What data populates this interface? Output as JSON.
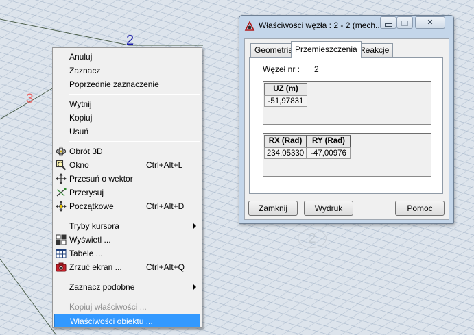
{
  "viewport": {
    "node_labels": [
      "2",
      "3",
      "2"
    ]
  },
  "context_menu": {
    "items": [
      {
        "label": "Anuluj",
        "shortcut": "",
        "icon": "",
        "disabled": false
      },
      {
        "label": "Zaznacz",
        "shortcut": "",
        "icon": "",
        "disabled": false
      },
      {
        "label": "Poprzednie zaznaczenie",
        "shortcut": "",
        "icon": "",
        "disabled": false
      },
      {
        "label": "Wytnij",
        "shortcut": "",
        "icon": "",
        "disabled": false
      },
      {
        "label": "Kopiuj",
        "shortcut": "",
        "icon": "",
        "disabled": false
      },
      {
        "label": "Usuń",
        "shortcut": "",
        "icon": "",
        "disabled": false
      },
      {
        "label": "Obrót 3D",
        "shortcut": "",
        "icon": "rotate-3d-icon",
        "disabled": false
      },
      {
        "label": "Okno",
        "shortcut": "Ctrl+Alt+L",
        "icon": "zoom-window-icon",
        "disabled": false
      },
      {
        "label": "Przesuń o wektor",
        "shortcut": "",
        "icon": "move-vector-icon",
        "disabled": false
      },
      {
        "label": "Przerysuj",
        "shortcut": "",
        "icon": "redraw-icon",
        "disabled": false
      },
      {
        "label": "Początkowe",
        "shortcut": "Ctrl+Alt+D",
        "icon": "initial-view-icon",
        "disabled": false
      },
      {
        "label": "Tryby kursora",
        "shortcut": "",
        "icon": "",
        "disabled": false,
        "submenu": true
      },
      {
        "label": "Wyświetl ...",
        "shortcut": "",
        "icon": "display-icon",
        "disabled": false
      },
      {
        "label": "Tabele ...",
        "shortcut": "",
        "icon": "tables-icon",
        "disabled": false
      },
      {
        "label": "Zrzuć ekran ...",
        "shortcut": "Ctrl+Alt+Q",
        "icon": "screen-capture-icon",
        "disabled": false
      },
      {
        "label": "Zaznacz podobne",
        "shortcut": "",
        "icon": "",
        "disabled": false,
        "submenu": true
      },
      {
        "label": "Kopiuj właściwości ...",
        "shortcut": "",
        "icon": "",
        "disabled": true
      },
      {
        "label": "Właściwości obiektu ...",
        "shortcut": "",
        "icon": "",
        "disabled": false,
        "highlighted": true
      }
    ]
  },
  "props_window": {
    "title": "Właściwości węzła : 2 - 2 (mech...",
    "tabs": [
      "Geometria",
      "Przemieszczenia",
      "Reakcje"
    ],
    "active_tab": "Przemieszczenia",
    "node_nr_label": "Węzeł nr :",
    "node_nr_value": "2",
    "uz_table": {
      "header": "UZ (m)",
      "value": "-51,97831"
    },
    "rot_table": {
      "headers": [
        "RX (Rad)",
        "RY (Rad)"
      ],
      "values": [
        "234,05330",
        "-47,00976"
      ]
    },
    "buttons": {
      "close": "Zamknij",
      "print": "Wydruk",
      "help": "Pomoc"
    },
    "close_glyph": "✕"
  }
}
